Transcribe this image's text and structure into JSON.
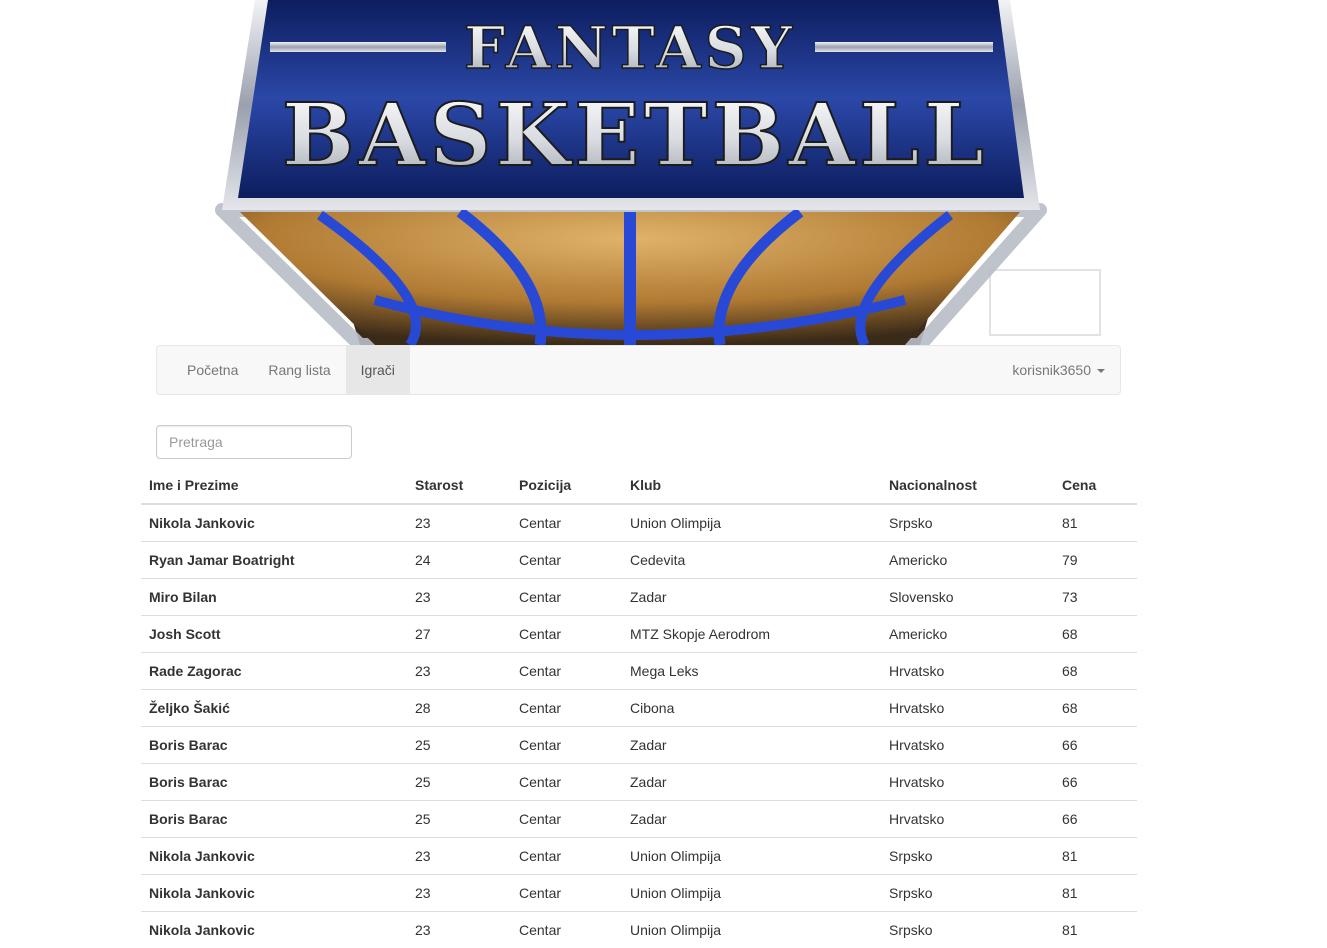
{
  "banner": {
    "logo_line1": "FANTASY",
    "logo_line2": "BASKETBALL",
    "colors": {
      "shield_blue": "#1f3a8f",
      "shield_dark": "#0d1d5e",
      "metal": "#c9cdd6",
      "ball_orange": "#c8923f",
      "ball_lines": "#2849d6"
    }
  },
  "navbar": {
    "items": [
      {
        "label": "Početna",
        "active": false
      },
      {
        "label": "Rang lista",
        "active": false
      },
      {
        "label": "Igrači",
        "active": true
      }
    ],
    "user": "korisnik3650"
  },
  "search": {
    "placeholder": "Pretraga",
    "value": ""
  },
  "table": {
    "headers": [
      "Ime i Prezime",
      "Starost",
      "Pozicija",
      "Klub",
      "Nacionalnost",
      "Cena"
    ],
    "rows": [
      [
        "Nikola Jankovic",
        "23",
        "Centar",
        "Union Olimpija",
        "Srpsko",
        "81"
      ],
      [
        "Ryan Jamar Boatright",
        "24",
        "Centar",
        "Cedevita",
        "Americko",
        "79"
      ],
      [
        "Miro Bilan",
        "23",
        "Centar",
        "Zadar",
        "Slovensko",
        "73"
      ],
      [
        "Josh Scott",
        "27",
        "Centar",
        "MTZ Skopje Aerodrom",
        "Americko",
        "68"
      ],
      [
        "Rade Zagorac",
        "23",
        "Centar",
        "Mega Leks",
        "Hrvatsko",
        "68"
      ],
      [
        "Željko Šakić",
        "28",
        "Centar",
        "Cibona",
        "Hrvatsko",
        "68"
      ],
      [
        "Boris Barac",
        "25",
        "Centar",
        "Zadar",
        "Hrvatsko",
        "66"
      ],
      [
        "Boris Barac",
        "25",
        "Centar",
        "Zadar",
        "Hrvatsko",
        "66"
      ],
      [
        "Boris Barac",
        "25",
        "Centar",
        "Zadar",
        "Hrvatsko",
        "66"
      ],
      [
        "Nikola Jankovic",
        "23",
        "Centar",
        "Union Olimpija",
        "Srpsko",
        "81"
      ],
      [
        "Nikola Jankovic",
        "23",
        "Centar",
        "Union Olimpija",
        "Srpsko",
        "81"
      ],
      [
        "Nikola Jankovic",
        "23",
        "Centar",
        "Union Olimpija",
        "Srpsko",
        "81"
      ]
    ]
  }
}
